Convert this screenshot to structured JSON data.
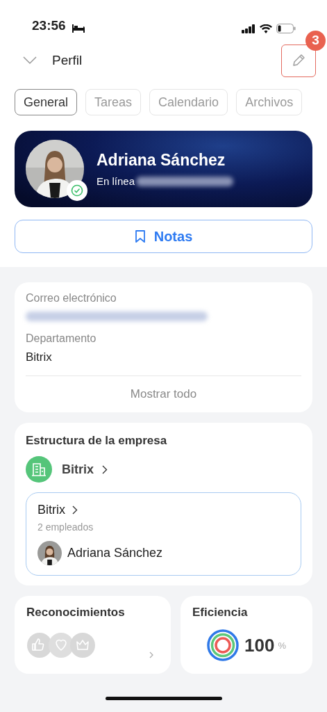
{
  "status_bar": {
    "time": "23:56"
  },
  "header": {
    "title": "Perfil",
    "edit_badge": "3"
  },
  "tabs": [
    {
      "label": "General",
      "selected": true
    },
    {
      "label": "Tareas",
      "selected": false
    },
    {
      "label": "Calendario",
      "selected": false
    },
    {
      "label": "Archivos",
      "selected": false
    }
  ],
  "profile": {
    "name": "Adriana Sánchez",
    "status": "En línea",
    "online": true
  },
  "notes_button": "Notas",
  "info": {
    "fields": [
      {
        "label": "Correo electrónico",
        "value_hidden": true
      },
      {
        "label": "Departamento",
        "value": "Bitrix"
      }
    ],
    "show_all": "Mostrar todo"
  },
  "structure": {
    "title": "Estructura de la empresa",
    "company": "Bitrix",
    "department": {
      "name": "Bitrix",
      "count": "2 empleados",
      "member": "Adriana Sánchez"
    }
  },
  "recognitions": {
    "title": "Reconocimientos"
  },
  "efficiency": {
    "title": "Eficiencia",
    "value": "100",
    "unit": "%"
  }
}
